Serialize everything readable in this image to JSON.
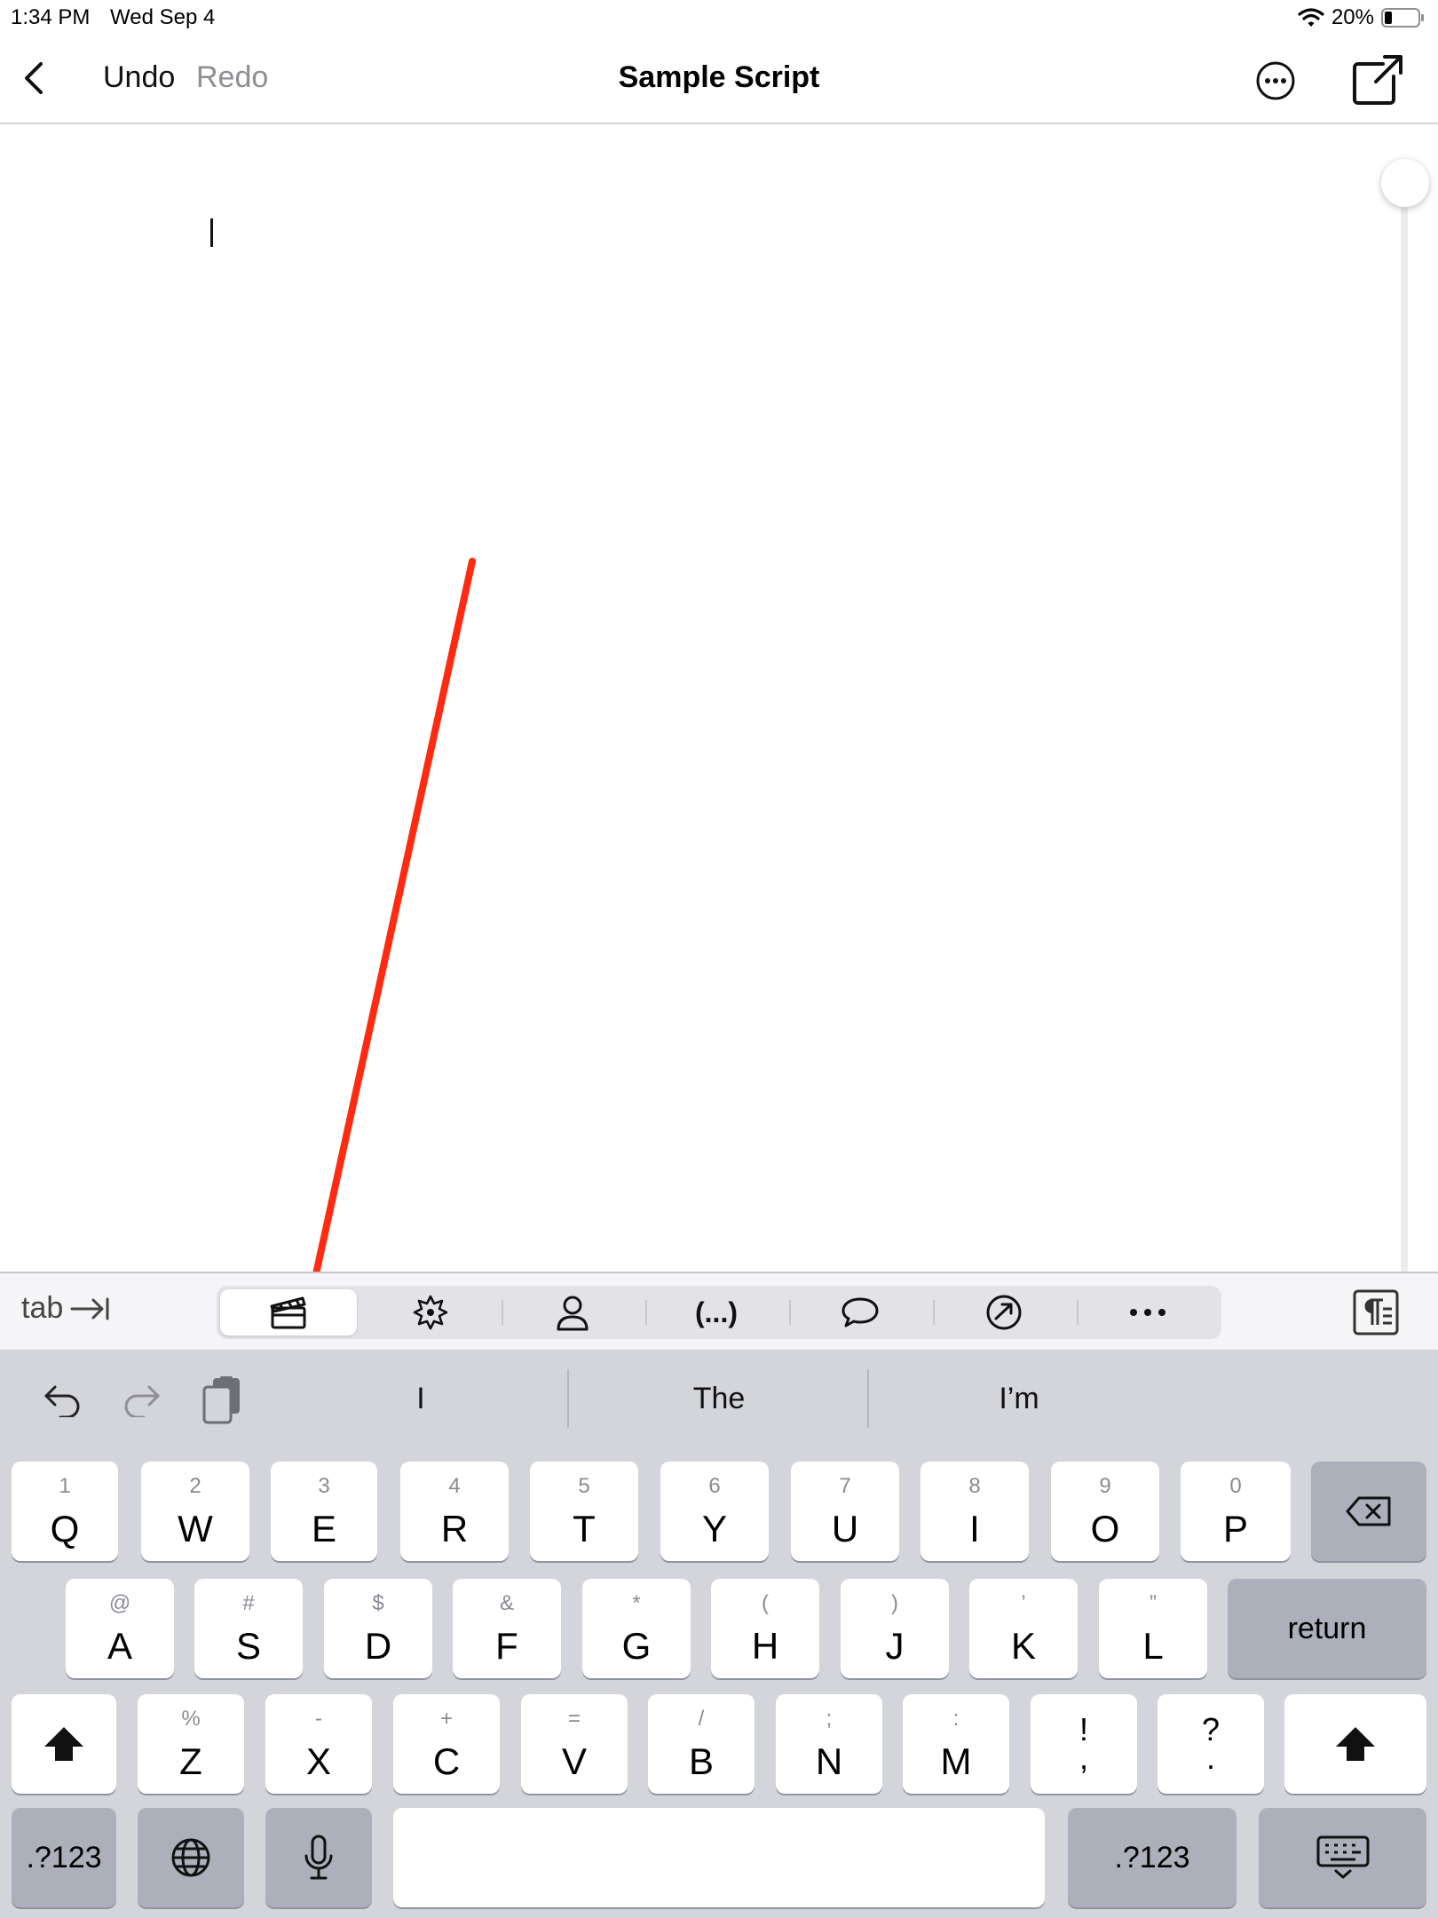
{
  "status": {
    "time": "1:34 PM",
    "date": "Wed Sep 4",
    "battery": "20%"
  },
  "nav": {
    "undo": "Undo",
    "redo": "Redo",
    "title": "Sample Script"
  },
  "toolbar": {
    "tab_label": "tab",
    "segments": [
      {
        "icon": "clapperboard-icon",
        "selected": true
      },
      {
        "icon": "action-burst-icon",
        "selected": false
      },
      {
        "icon": "character-person-icon",
        "selected": false
      },
      {
        "icon": "parenthetical-icon",
        "text": "(...)",
        "selected": false
      },
      {
        "icon": "dialogue-bubble-icon",
        "selected": false
      },
      {
        "icon": "transition-link-icon",
        "selected": false
      },
      {
        "icon": "more-dots-icon",
        "text": "•••",
        "selected": false
      }
    ]
  },
  "keyboard": {
    "suggestions": [
      "I",
      "The",
      "I’m"
    ],
    "row1": [
      {
        "alt": "1",
        "main": "Q"
      },
      {
        "alt": "2",
        "main": "W"
      },
      {
        "alt": "3",
        "main": "E"
      },
      {
        "alt": "4",
        "main": "R"
      },
      {
        "alt": "5",
        "main": "T"
      },
      {
        "alt": "6",
        "main": "Y"
      },
      {
        "alt": "7",
        "main": "U"
      },
      {
        "alt": "8",
        "main": "I"
      },
      {
        "alt": "9",
        "main": "O"
      },
      {
        "alt": "0",
        "main": "P"
      }
    ],
    "row2": [
      {
        "alt": "@",
        "main": "A"
      },
      {
        "alt": "#",
        "main": "S"
      },
      {
        "alt": "$",
        "main": "D"
      },
      {
        "alt": "&",
        "main": "F"
      },
      {
        "alt": "*",
        "main": "G"
      },
      {
        "alt": "(",
        "main": "H"
      },
      {
        "alt": ")",
        "main": "J"
      },
      {
        "alt": "’",
        "main": "K"
      },
      {
        "alt": "”",
        "main": "L"
      }
    ],
    "row3": [
      {
        "alt": "%",
        "main": "Z"
      },
      {
        "alt": "-",
        "main": "X"
      },
      {
        "alt": "+",
        "main": "C"
      },
      {
        "alt": "=",
        "main": "V"
      },
      {
        "alt": "/",
        "main": "B"
      },
      {
        "alt": ";",
        "main": "N"
      },
      {
        "alt": ":",
        "main": "M"
      }
    ],
    "punct1": {
      "top": "!",
      "bottom": ","
    },
    "punct2": {
      "top": "?",
      "bottom": "."
    },
    "return_label": "return",
    "numbers_left": ".?123",
    "numbers_right": ".?123"
  },
  "colors": {
    "accent_arrow": "#ff2a10",
    "keyboard_bg": "#d3d5db",
    "key_dark": "#abb0ba"
  }
}
